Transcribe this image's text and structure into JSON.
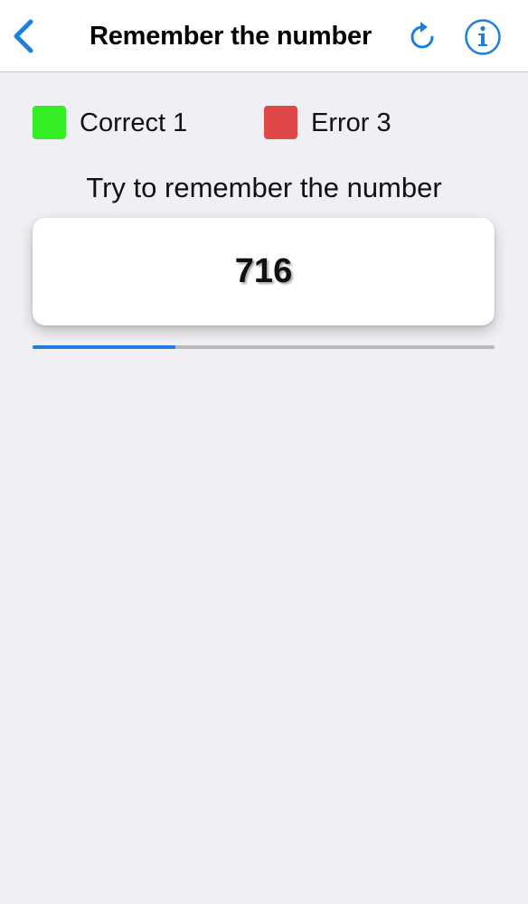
{
  "nav": {
    "title": "Remember the number",
    "back_icon": "chevron-left-icon",
    "refresh_icon": "refresh-icon",
    "info_icon": "info-icon",
    "accent_color": "#1b7fe0"
  },
  "score": {
    "correct": {
      "label": "Correct 1",
      "color": "#33ee22"
    },
    "error": {
      "label": "Error 3",
      "color": "#e04848"
    }
  },
  "instruction": "Try to remember the number",
  "number": "716",
  "progress": {
    "fraction": 0.31
  }
}
